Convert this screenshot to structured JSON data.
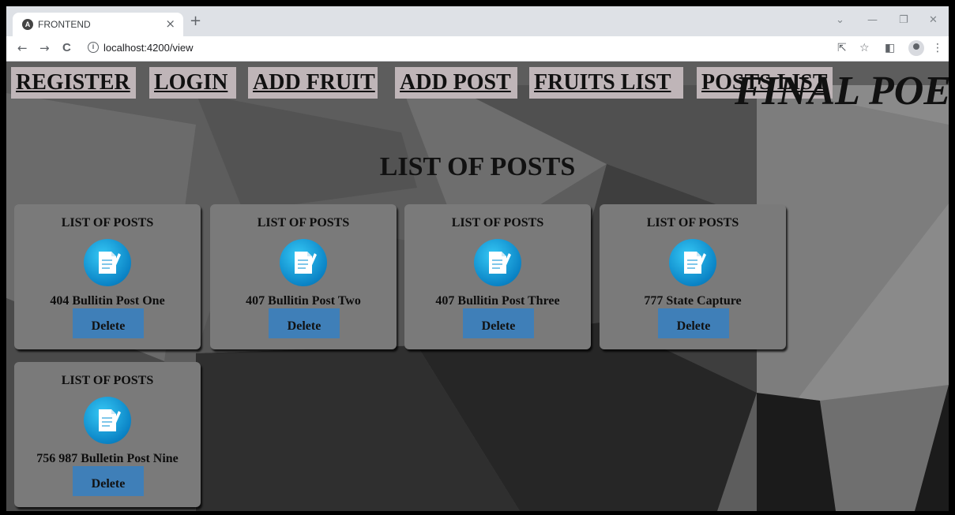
{
  "browser": {
    "tab_title": "FRONTEND",
    "tab_icon_letter": "A",
    "tab_close": "×",
    "new_tab": "+",
    "url": "localhost:4200/view",
    "info_symbol": "i",
    "back": "←",
    "forward": "→",
    "reload": "C",
    "share": "⇱",
    "bookmark": "☆",
    "side_panel": "◧",
    "menu": "⋮",
    "tab_search": "⌄",
    "minimize": "—",
    "restore": "❐",
    "close": "✕"
  },
  "nav": {
    "register": "REGISTER",
    "login": "LOGIN",
    "add_fruit": "ADD FRUIT",
    "add_post": "ADD POST",
    "fruits_list": "FRUITS LIST",
    "posts_list": "POSTS LIST"
  },
  "brand": "FINAL POE",
  "heading": "LIST OF POSTS",
  "cards": [
    {
      "title": "LIST OF POSTS",
      "name": "404 Bullitin Post One",
      "delete_label": "Delete"
    },
    {
      "title": "LIST OF POSTS",
      "name": "407 Bullitin Post Two",
      "delete_label": "Delete"
    },
    {
      "title": "LIST OF POSTS",
      "name": "407 Bullitin Post Three",
      "delete_label": "Delete"
    },
    {
      "title": "LIST OF POSTS",
      "name": "777 State Capture",
      "delete_label": "Delete"
    },
    {
      "title": "LIST OF POSTS",
      "name": "756 987 Bulletin Post Nine",
      "delete_label": "Delete"
    }
  ],
  "colors": {
    "card_bg": "#7a7a7a",
    "delete_button": "#3f7fb8",
    "nav_bg": "#bfb5b8",
    "icon_blue": "#0b84c6"
  }
}
